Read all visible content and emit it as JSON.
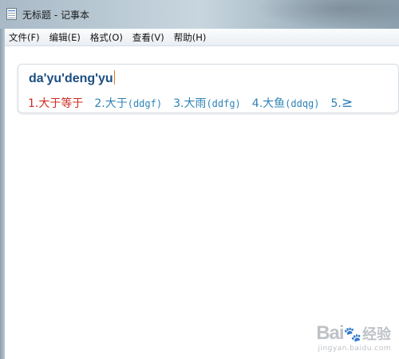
{
  "window": {
    "title": "无标题 - 记事本"
  },
  "menu": [
    {
      "label": "文件(F)"
    },
    {
      "label": "编辑(E)"
    },
    {
      "label": "格式(O)"
    },
    {
      "label": "查看(V)"
    },
    {
      "label": "帮助(H)"
    }
  ],
  "ime": {
    "composition": "da'yu'deng'yu",
    "candidates": [
      {
        "index": "1.",
        "text": "大于等于",
        "code": "",
        "selected": true
      },
      {
        "index": "2.",
        "text": "大于",
        "code": "(ddgf)",
        "selected": false
      },
      {
        "index": "3.",
        "text": "大雨",
        "code": "(ddfg)",
        "selected": false
      },
      {
        "index": "4.",
        "text": "大鱼",
        "code": "(ddqg)",
        "selected": false
      }
    ],
    "next_index": "5.",
    "next_arrow": "≥"
  },
  "watermark": {
    "logo_a": "Bai",
    "logo_paw": "🐾",
    "logo_b": "经验",
    "url": "jingyan.baidu.com"
  },
  "colors": {
    "selected_candidate": "#cf2b22",
    "candidate": "#2e83b6",
    "composition": "#1c4f82"
  }
}
